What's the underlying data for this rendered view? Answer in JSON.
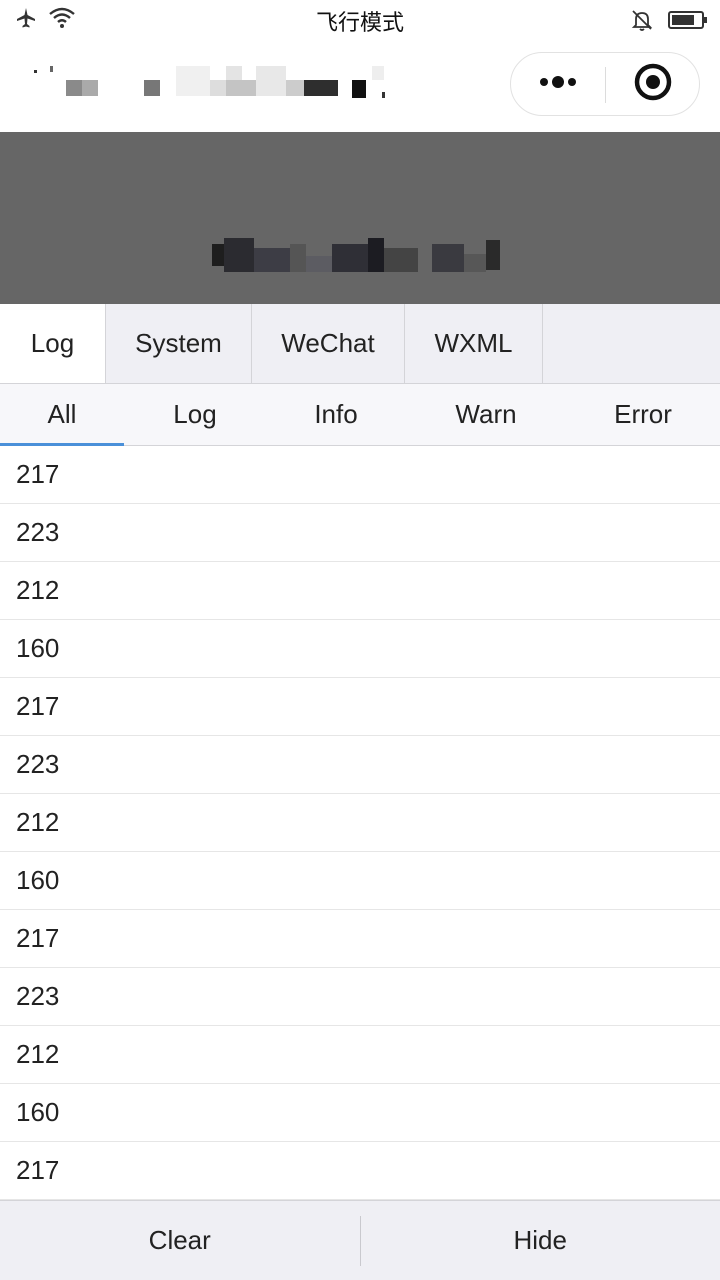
{
  "status_bar": {
    "title": "飞行模式",
    "icons": [
      "airplane-icon",
      "wifi-icon",
      "mute-bell-icon",
      "battery-icon"
    ]
  },
  "nav_bar": {
    "title": "",
    "capsule": {
      "more_icon": "more-dots-icon",
      "close_icon": "target-icon"
    }
  },
  "banner": {
    "text": ""
  },
  "main_tabs": [
    {
      "label": "Log",
      "active": true
    },
    {
      "label": "System",
      "active": false
    },
    {
      "label": "WeChat",
      "active": false
    },
    {
      "label": "WXML",
      "active": false
    }
  ],
  "sub_tabs": [
    {
      "label": "All",
      "active": true
    },
    {
      "label": "Log",
      "active": false
    },
    {
      "label": "Info",
      "active": false
    },
    {
      "label": "Warn",
      "active": false
    },
    {
      "label": "Error",
      "active": false
    }
  ],
  "log_entries": [
    "217",
    "223",
    "212",
    "160",
    "217",
    "223",
    "212",
    "160",
    "217",
    "223",
    "212",
    "160",
    "217"
  ],
  "bottom_bar": {
    "clear_label": "Clear",
    "hide_label": "Hide"
  },
  "colors": {
    "banner": "#666666",
    "tab_bar": "#efeff4",
    "accent": "#4a90d9"
  }
}
